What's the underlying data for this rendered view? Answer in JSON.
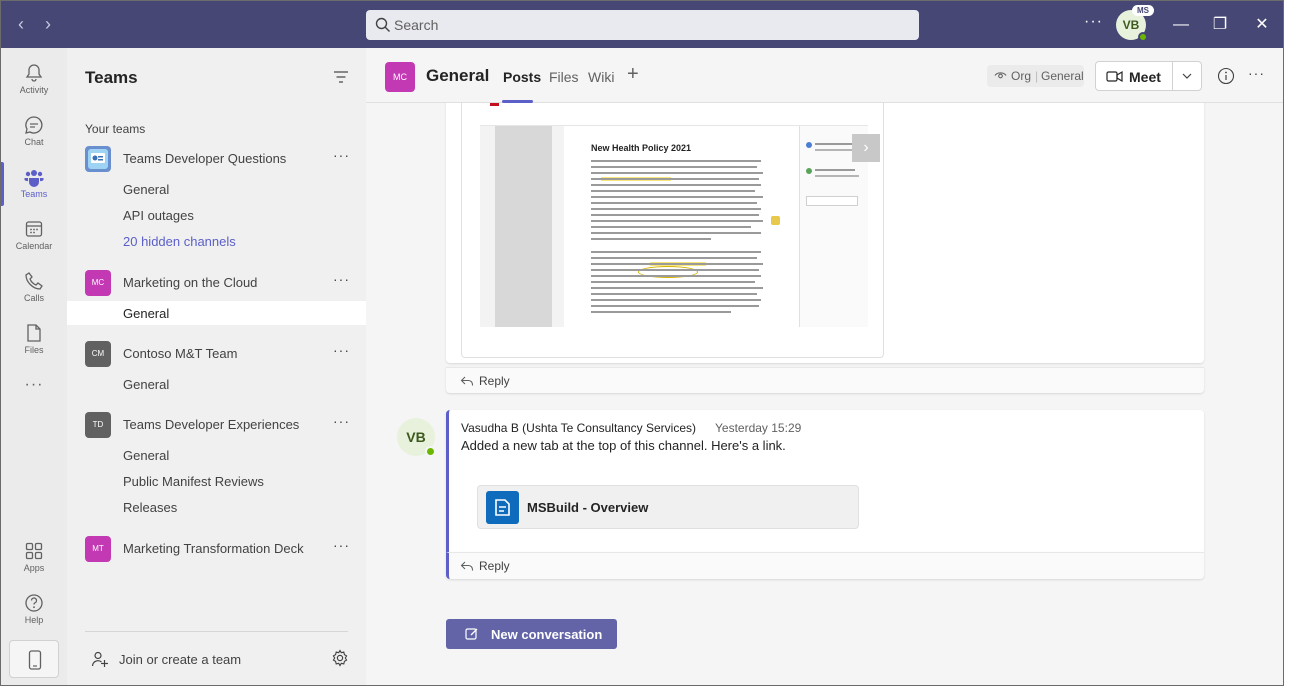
{
  "titlebar": {
    "back_glyph": "‹",
    "forward_glyph": "›",
    "search_placeholder": "Search",
    "more_glyph": "···",
    "user_initials": "VB",
    "org_badge": "MS",
    "minimize_glyph": "—",
    "restore_glyph": "❐",
    "close_glyph": "✕",
    "bg_color": "#464775"
  },
  "rail": {
    "items": [
      {
        "label": "Activity",
        "icon": "bell-icon"
      },
      {
        "label": "Chat",
        "icon": "chat-icon"
      },
      {
        "label": "Teams",
        "icon": "teams-icon",
        "active": true
      },
      {
        "label": "Calendar",
        "icon": "calendar-icon"
      },
      {
        "label": "Calls",
        "icon": "phone-icon"
      },
      {
        "label": "Files",
        "icon": "file-icon"
      },
      {
        "label": "Apps",
        "icon": "apps-icon"
      },
      {
        "label": "Help",
        "icon": "help-icon"
      }
    ],
    "more_glyph": "···"
  },
  "panel": {
    "title": "Teams",
    "section_label": "Your teams",
    "teams": [
      {
        "name": "Teams Developer Questions",
        "initials": "",
        "color": "#7a9bd6",
        "channels": [
          "General",
          "API outages"
        ],
        "hidden_channels": "20 hidden channels"
      },
      {
        "name": "Marketing on the Cloud",
        "initials": "MC",
        "color": "#c239b3",
        "channels": [
          "General"
        ]
      },
      {
        "name": "Contoso M&T Team",
        "initials": "CM",
        "color": "#616161",
        "channels": [
          "General"
        ]
      },
      {
        "name": "Teams Developer Experiences",
        "initials": "TD",
        "color": "#616161",
        "channels": [
          "General",
          "Public Manifest Reviews",
          "Releases"
        ]
      },
      {
        "name": "Marketing Transformation Deck",
        "initials": "MT",
        "color": "#c239b3",
        "channels": []
      }
    ],
    "more_glyph": "···",
    "join_label": "Join or create a team"
  },
  "header": {
    "initials": "MC",
    "channel_name": "General",
    "tabs": [
      "Posts",
      "Files",
      "Wiki"
    ],
    "add_tab_glyph": "+",
    "org_label": "Org",
    "org_channel": "General",
    "org_separator": "|",
    "meet_label": "Meet",
    "more_glyph": "···"
  },
  "conversation": {
    "preview_doc_title": "New Health Policy 2021",
    "preview_next_glyph": "›",
    "reply_label": "Reply",
    "message": {
      "initials": "VB",
      "sender": "Vasudha B (Ushta Te Consultancy Services)",
      "timestamp": "Yesterday 15:29",
      "text": "Added a new tab at the top of this channel. Here's a link.",
      "link_title": "MSBuild - Overview"
    },
    "reply_label_2": "Reply",
    "new_conversation_label": "New conversation"
  },
  "colors": {
    "accent": "#5b5fc7",
    "button": "#6264a7",
    "presence": "#6bb700"
  }
}
